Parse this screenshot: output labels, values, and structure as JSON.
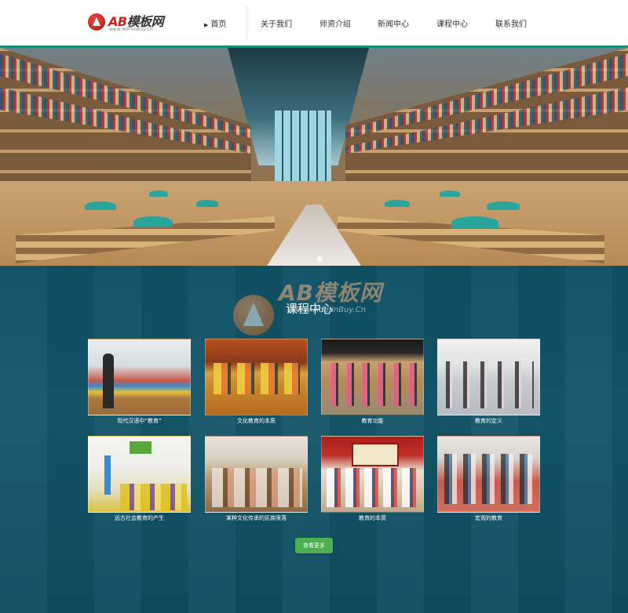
{
  "logo": {
    "brand_letters": "AB",
    "brand_text": "模板网",
    "subtitle": "www.AdminBuy.Cn"
  },
  "nav": {
    "items": [
      {
        "label": "首页"
      },
      {
        "label": "关于我们"
      },
      {
        "label": "师资介绍"
      },
      {
        "label": "新闻中心"
      },
      {
        "label": "课程中心"
      },
      {
        "label": "联系我们"
      }
    ]
  },
  "section": {
    "title": "课程中心"
  },
  "watermark": {
    "text": "AB模板网",
    "subtitle": "WWW.AdminBuy.Cn"
  },
  "courses": [
    {
      "caption": "现代汉语中“教育”"
    },
    {
      "caption": "文化教育的本质"
    },
    {
      "caption": "教育功能"
    },
    {
      "caption": "教育的定义"
    },
    {
      "caption": "远古社会教育的产生"
    },
    {
      "caption": "某种文化传承的民族限落"
    },
    {
      "caption": "教育的本质"
    },
    {
      "caption": "宏观的教育"
    }
  ],
  "more_button": {
    "label": "查看更多"
  },
  "colors": {
    "header_border": "#1a8a7a",
    "content_bg": "#15566a",
    "button_bg": "#4caf50",
    "brand_red": "#c9241b"
  }
}
